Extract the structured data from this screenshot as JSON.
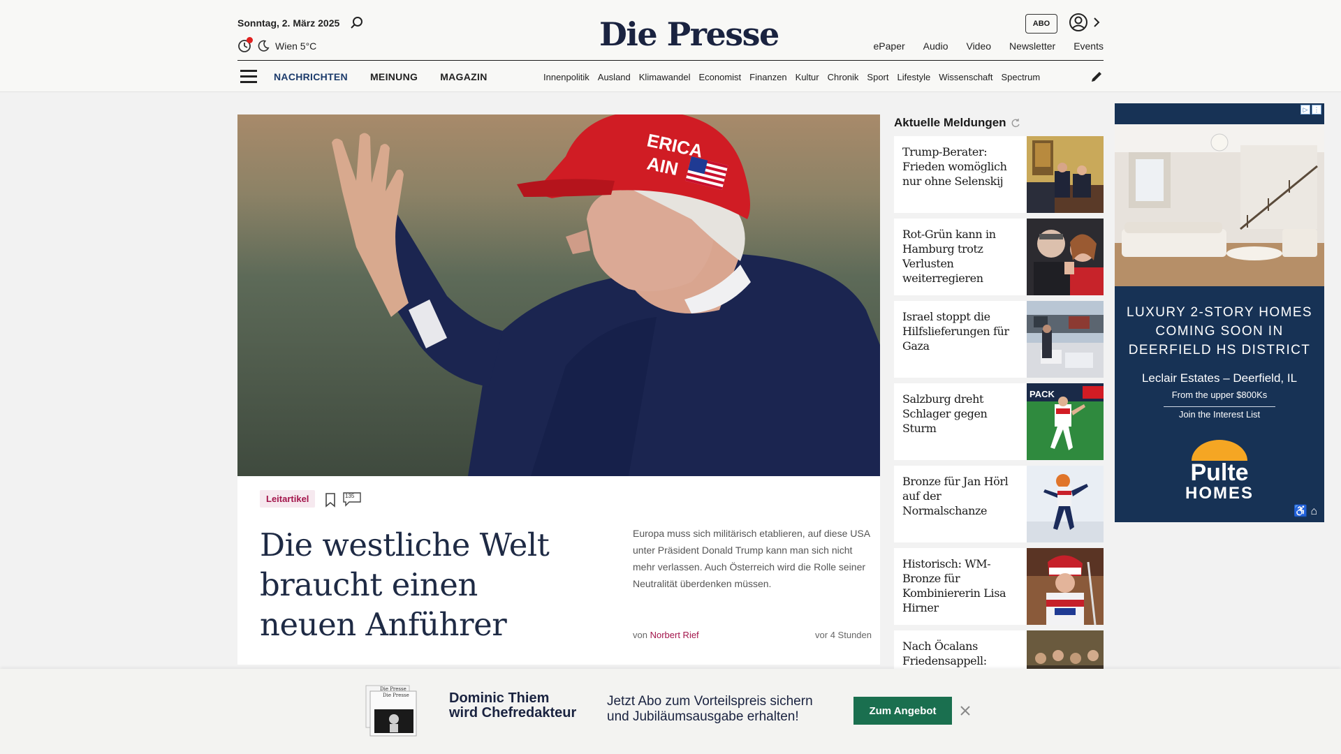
{
  "header": {
    "date": "Sonntag, 2. März 2025",
    "weather": "Wien 5°C",
    "logo": "Die Presse",
    "abo_label": "ABO",
    "top_links": [
      "ePaper",
      "Audio",
      "Video",
      "Newsletter",
      "Events"
    ],
    "main_nav": [
      "NACHRICHTEN",
      "MEINUNG",
      "MAGAZIN"
    ],
    "sub_nav": [
      "Innenpolitik",
      "Ausland",
      "Klimawandel",
      "Economist",
      "Finanzen",
      "Kultur",
      "Chronik",
      "Sport",
      "Lifestyle",
      "Wissenschaft",
      "Spectrum"
    ]
  },
  "hero": {
    "kicker": "Leitartikel",
    "comment_count": "135",
    "headline": "Die westliche Welt braucht einen neuen Anführer",
    "teaser": "Europa muss sich militärisch etablieren, auf diese USA unter Präsident Donald Trump kann man sich nicht mehr verlassen. Auch Österreich wird die Rolle seiner Neutralität überdenken müssen.",
    "byline_prefix": "von",
    "author": "Norbert Rief",
    "time": "vor 4 Stunden"
  },
  "latest": {
    "title": "Aktuelle Meldungen",
    "items": [
      {
        "title": "Trump-Berater: Frieden womöglich nur ohne Selenskij"
      },
      {
        "title": "Rot-Grün kann in Hamburg trotz Verlusten weiterregieren"
      },
      {
        "title": "Israel stoppt die Hilfslieferungen für Gaza"
      },
      {
        "title": "Salzburg dreht Schlager gegen Sturm"
      },
      {
        "title": "Bronze für Jan Hörl auf der Normalschanze"
      },
      {
        "title": "Historisch: WM-Bronze für Kombiniererin Lisa Hirner"
      },
      {
        "title": "Nach Öcalans Friedensappell:"
      }
    ]
  },
  "ad": {
    "headline_lines": [
      "LUXURY 2-STORY HOMES",
      "COMING SOON IN",
      "DEERFIELD HS DISTRICT"
    ],
    "location": "Leclair Estates – Deerfield, IL",
    "price": "From the upper $800Ks",
    "cta": "Join the Interest List",
    "logo_top": "Pulte",
    "logo_bottom": "HOMES"
  },
  "banner": {
    "title_lines": [
      "Dominic Thiem",
      "wird Chefredakteur"
    ],
    "text_lines": [
      "Jetzt Abo zum Vorteilspreis sichern",
      "und Jubiläumsausgabe erhalten!"
    ],
    "button": "Zum Angebot"
  },
  "colors": {
    "accent_red": "#a3154b",
    "nav_active": "#1c3b6b",
    "button_green": "#1a6f4f",
    "ad_navy": "#173255"
  }
}
